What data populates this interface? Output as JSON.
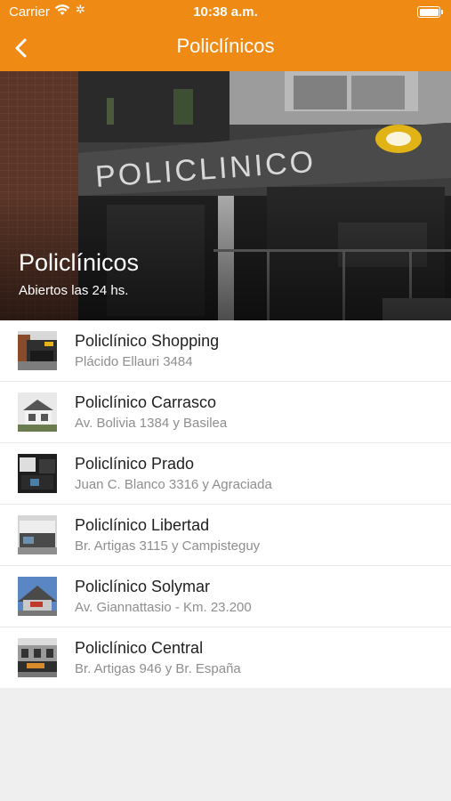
{
  "status_bar": {
    "carrier": "Carrier",
    "time": "10:38 a.m."
  },
  "nav": {
    "title": "Policlínicos",
    "back_icon": "chevron-left-icon"
  },
  "hero": {
    "image_sign_text": "POLICLINICO",
    "title": "Policlínicos",
    "subtitle": "Abiertos las 24 hs."
  },
  "colors": {
    "accent": "#ef8b14",
    "list_bg": "#ffffff",
    "page_bg": "#efefef",
    "secondary_text": "#8e8e8e"
  },
  "clinics": [
    {
      "name": "Policlínico Shopping",
      "address": "Plácido Ellauri 3484"
    },
    {
      "name": "Policlínico Carrasco",
      "address": "Av. Bolivia 1384 y Basilea"
    },
    {
      "name": "Policlínico Prado",
      "address": "Juan C. Blanco 3316 y Agraciada"
    },
    {
      "name": "Policlínico Libertad",
      "address": "Br. Artigas 3115 y Campisteguy"
    },
    {
      "name": "Policlínico Solymar",
      "address": "Av. Giannattasio - Km. 23.200"
    },
    {
      "name": "Policlínico Central",
      "address": "Br. Artigas 946 y Br. España"
    }
  ]
}
